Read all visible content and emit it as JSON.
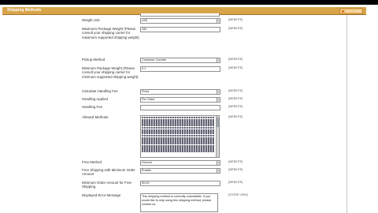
{
  "header": {
    "title": "Shipping Methods",
    "save_label": "Save Config"
  },
  "rows": {
    "weight_unit": {
      "label": "Weight Unit",
      "value": "LBS",
      "scope": "[WEBSITE]"
    },
    "max_weight": {
      "label": "Maximum Package Weight (Please consult your shipping carrier for maximum supported shipping weight)",
      "value": "150",
      "scope": "[WEBSITE]"
    },
    "pickup_method": {
      "label": "Pickup Method",
      "value": "Customer Counter",
      "scope": "[WEBSITE]"
    },
    "min_weight": {
      "label": "Minimum Package Weight (Please consult your shipping carrier for minimum supported shipping weight)",
      "value": "0.1",
      "scope": "[WEBSITE]"
    },
    "calc_handling": {
      "label": "Calculate Handling Fee",
      "value": "Fixed",
      "scope": "[WEBSITE]"
    },
    "handling_applied": {
      "label": "Handling Applied",
      "value": "Per Order",
      "scope": "[WEBSITE]"
    },
    "handling_fee": {
      "label": "Handling Fee",
      "value": "",
      "scope": "[WEBSITE]"
    },
    "allowed_methods": {
      "label": "Allowed Methods",
      "scope": "[WEBSITE]"
    },
    "free_method": {
      "label": "Free Method",
      "value": "Ground",
      "scope": "[WEBSITE]"
    },
    "free_min": {
      "label": "Free Shipping with Minimum Order Amount",
      "value": "Enable",
      "scope": "[WEBSITE]"
    },
    "min_order": {
      "label": "Minimum Order Amount for Free Shipping",
      "value": "50.00",
      "scope": "[WEBSITE]"
    },
    "error_msg": {
      "label": "Displayed Error Message",
      "value": "This shipping method is currently unavailable. If you would like to ship using this shipping method, please contact us.",
      "scope": "[STORE VIEW]"
    }
  }
}
